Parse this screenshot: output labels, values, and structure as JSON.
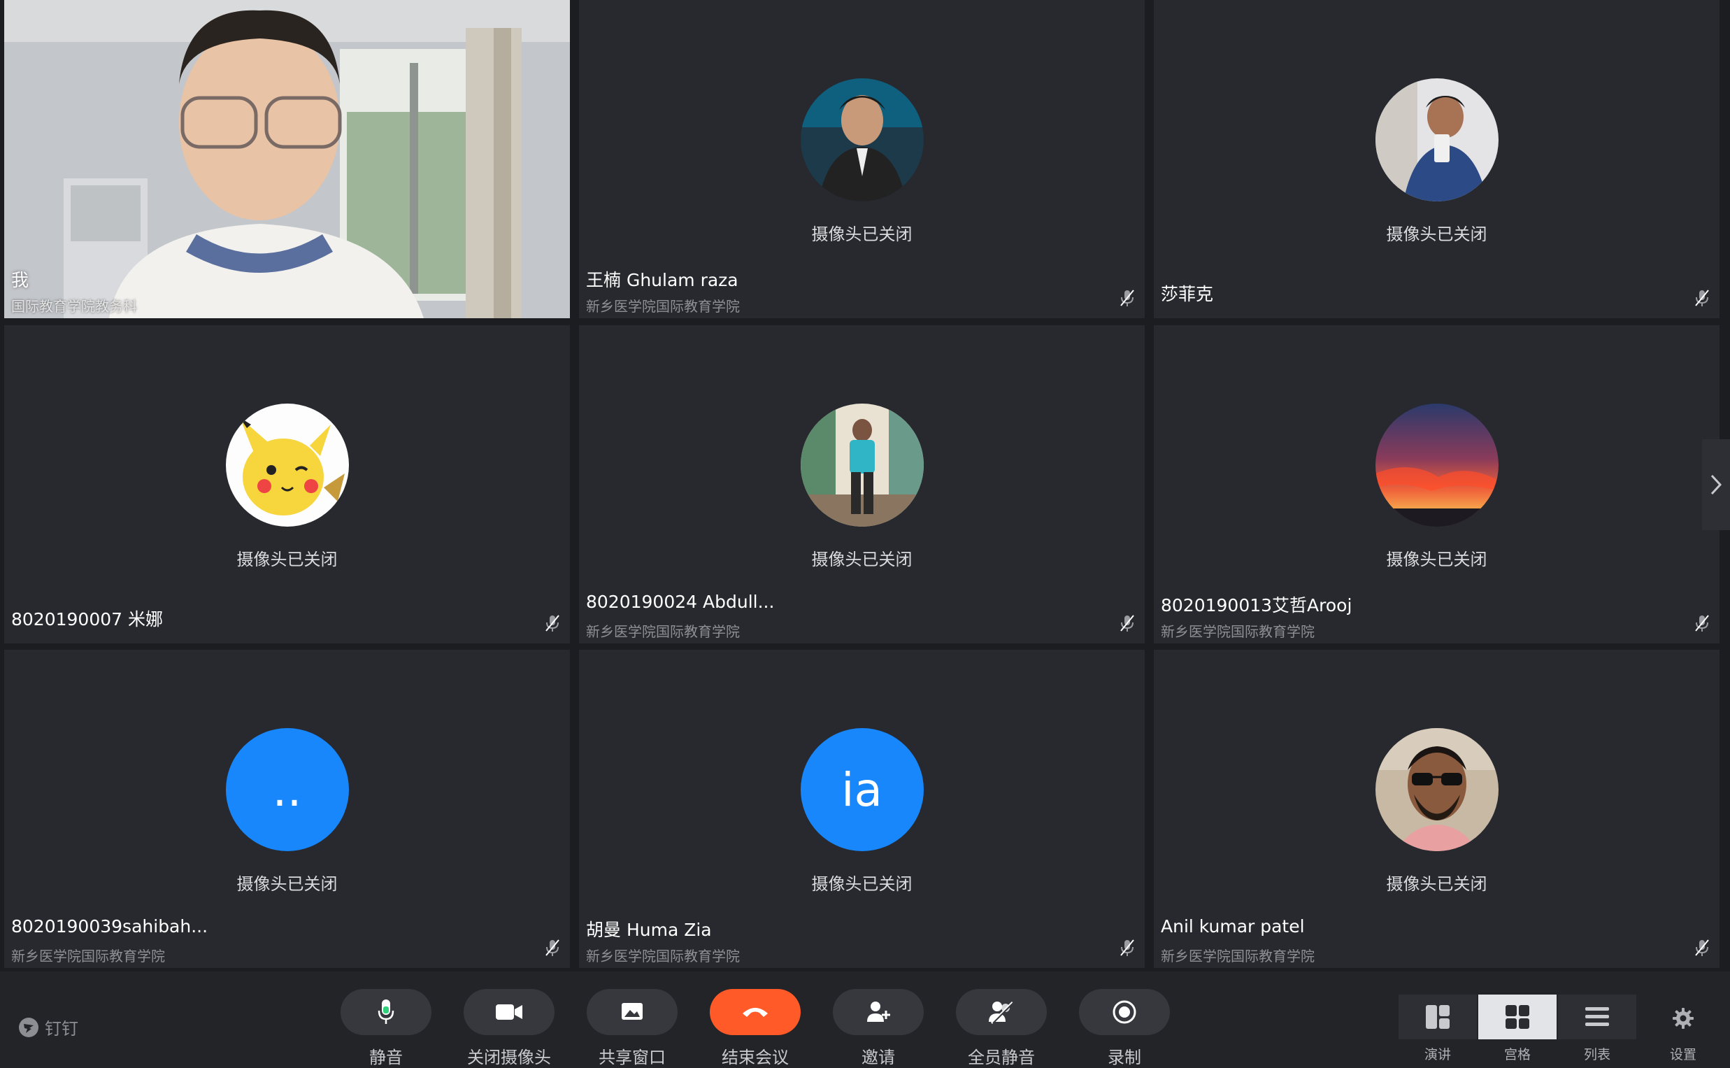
{
  "camera_off_label": "摄像头已关闭",
  "participants": [
    {
      "name": "我",
      "org": "国际教育学院教务科",
      "video": true
    },
    {
      "name": "王楠 Ghulam raza",
      "org": "新乡医学院国际教育学院",
      "avatar": "photo-man-suit"
    },
    {
      "name": "莎菲克",
      "org": "",
      "avatar": "photo-man-phone"
    },
    {
      "name": "8020190007 米娜",
      "org": "",
      "avatar": "pikachu"
    },
    {
      "name": "8020190024 Abdull...",
      "org": "新乡医学院国际教育学院",
      "avatar": "photo-man-outdoor"
    },
    {
      "name": "8020190013艾哲Arooj",
      "org": "新乡医学院国际教育学院",
      "avatar": "sunset"
    },
    {
      "name": "8020190039sahibah...",
      "org": "新乡医学院国际教育学院",
      "avatar_text": "..",
      "avatar_color": "#1787fb"
    },
    {
      "name": "胡曼 Huma Zia",
      "org": "新乡医学院国际教育学院",
      "avatar_text": "ia",
      "avatar_color": "#1787fb"
    },
    {
      "name": "Anil kumar patel",
      "org": "新乡医学院国际教育学院",
      "avatar": "photo-man-sunglasses"
    }
  ],
  "brand": {
    "name": "钉钉"
  },
  "toolbar": {
    "mute": "静音",
    "camera_off": "关闭摄像头",
    "share_window": "共享窗口",
    "end_meeting": "结束会议",
    "invite": "邀请",
    "mute_all": "全员静音",
    "record": "录制"
  },
  "views": {
    "speaker": "演讲",
    "grid": "宫格",
    "list": "列表",
    "settings": "设置"
  },
  "colors": {
    "end_button": "#ff5a27",
    "avatar_blue": "#1787fb",
    "tile_bg": "#27292e"
  }
}
